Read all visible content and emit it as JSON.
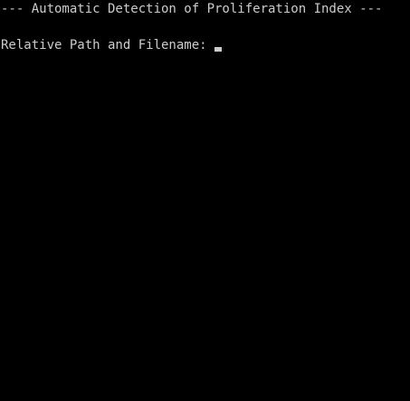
{
  "console": {
    "title_line": "--- Automatic Detection of Proliferation Index ---",
    "prompt": "Relative Path and Filename: ",
    "input_value": "",
    "colors": {
      "background": "#000000",
      "text": "#cccccc"
    }
  }
}
